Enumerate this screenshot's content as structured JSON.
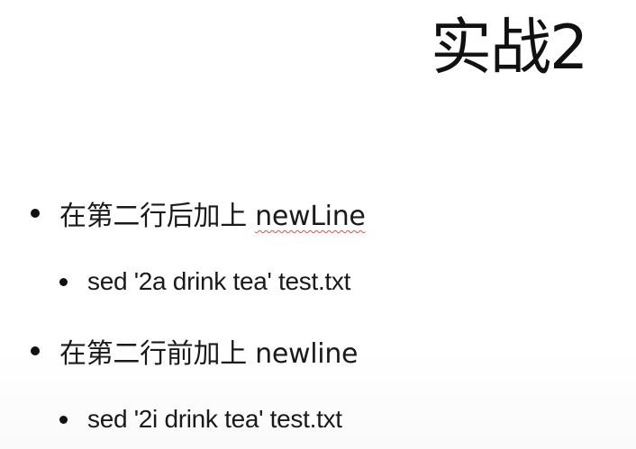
{
  "slide": {
    "title": "实战2",
    "bullets": [
      {
        "prefix": "在第二行后加上 ",
        "keyword": "newLine"
      },
      {
        "text": "sed '2a drink tea' test.txt"
      },
      {
        "prefix": "在第二行前加上 ",
        "keyword": "newline"
      },
      {
        "text": "sed '2i drink tea' test.txt"
      }
    ]
  }
}
